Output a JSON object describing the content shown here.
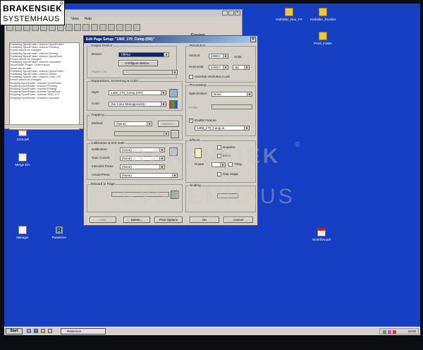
{
  "brand": {
    "line1": "BRAKENSIEK",
    "line2": "SYSTEMHAUS",
    "reg": "®"
  },
  "desktop_icons": [
    {
      "name": "hotfolder-ps-neu",
      "label": "Hotfolder_Neu_PS",
      "kind": "folder"
    },
    {
      "name": "hotfolder-ps-print",
      "label": "Hotfolder_Drucker",
      "kind": "folder"
    },
    {
      "name": "proof-folder",
      "label": "Proof_Folder",
      "kind": "folder"
    },
    {
      "name": "pdf-file-1",
      "label": "1234.pdf",
      "kind": "pdf"
    },
    {
      "name": "merge-app",
      "label": "Merge EFI",
      "kind": "doc"
    },
    {
      "name": "manager-app",
      "label": "Manager",
      "kind": "doc"
    },
    {
      "name": "rasterizer-app",
      "label": "Rasterizer",
      "kind": "rip"
    },
    {
      "name": "workflow-pdf",
      "label": "Workflow.pdf",
      "kind": "pdf"
    }
  ],
  "back_window": {
    "menu": [
      "View",
      "Help"
    ],
    "preview_label": "Preview",
    "log_lines": [
      "Publishing SpoolFolder: channel SpoolFolder",
      "Publishing SpoolFolder: channel Pending",
      "Preset cannot be changed",
      "Publishing SpoolFolder: channel Printing",
      "Publishing SpoolFolder: channel SpoolDone",
      "Preset cannot be changed",
      "Publishing SpoolFolder: channel Cancelled",
      "SpoolFolder Plugin: Control spool",
      "Spool can no start",
      "Publishing SpoolFolder: channel SpoolFolder",
      "Publishing SpoolFolder: channel Select",
      "Publishing SpoolFolder: channel 1400_170",
      "Preset cannot be changed",
      "Stopping SpoolFolder: channel SpoolFolder",
      "Stopping SpoolFolder: channel Pending",
      "Stopping SpoolFolder: channel Printing",
      "Stopping SpoolFolder: channel SpoolDone",
      "Stopping SpoolFolder: channel 1400_170",
      "Stopping SpoolFolder: channel Cancelled"
    ]
  },
  "dialog": {
    "title": "Edit Page Setup: \"1400_170_Comp (DR)\"",
    "close": "×",
    "output_device": {
      "group": "Output Device",
      "device_label": "Device:",
      "device_value": "TiffPlot",
      "configure_button": "Configure device...",
      "paper_label": "Paper size:"
    },
    "separations": {
      "group": "Separations, Screening & Color",
      "style_label": "Style:",
      "style_value": "1400_170_Comp (HFI)",
      "color_label": "Color:",
      "color_value": "(No Color Management)"
    },
    "trapping": {
      "group": "Trapping",
      "method_label": "Method:",
      "method_value": "(None)",
      "options_button": "Options..."
    },
    "calibration": {
      "group": "Calibration & Dot Gain",
      "calibration_label": "Calibration:",
      "calibration_value": "(None)",
      "tone_curves_label": "Tone Curves:",
      "tone_curves_value": "(None)",
      "intended_press_label": "Intended Press:",
      "intended_press_value": "(None)",
      "actual_press_label": "Actual Press:",
      "actual_press_value": "(None)"
    },
    "discard_pages": {
      "group": "Discard in Page"
    },
    "resolution": {
      "group": "Resolution",
      "vertical_label": "Vertical:",
      "vertical_value": "2400.0",
      "horizontal_label": "Horizontal:",
      "horizontal_value": "2400.0",
      "units_label": "Units:",
      "units_value": "dpi",
      "override_label": "Override resolution in job"
    },
    "processing": {
      "group": "Processing",
      "optimization_label": "Optimization:",
      "optimization_value": "None",
      "prototype_label": "Profile:",
      "enable_feature_label": "Enable Feature",
      "feature_value": "1400_170_Comp.in"
    },
    "effects": {
      "group": "Effects",
      "negative_label": "Negative",
      "mirror_label": "Mirror",
      "rotate_label": "Rotate",
      "tile_label": "Tiling",
      "gap_label": "Gap usage"
    },
    "scaling": {
      "group": "Scaling"
    },
    "buttons": {
      "delete": "Delete...",
      "print_options": "Print Options",
      "ok": "OK",
      "cancel": "Cancel",
      "help": "Help"
    }
  },
  "taskbar": {
    "start": "Start",
    "task_item": "Rasterizer",
    "clock": "15:02"
  },
  "colors": {
    "desktop": "#163fc4",
    "title_active": "#0a246a"
  }
}
